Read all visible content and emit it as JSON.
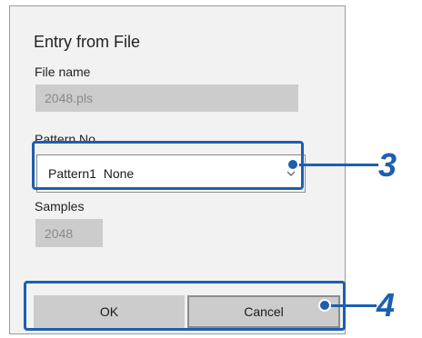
{
  "dialog": {
    "title": "Entry from File",
    "file_name": {
      "label": "File name",
      "value": "2048.pls"
    },
    "pattern_no": {
      "label": "Pattern No.",
      "selected": "Pattern1  None"
    },
    "samples": {
      "label": "Samples",
      "value": "2048"
    },
    "buttons": {
      "ok": "OK",
      "cancel": "Cancel"
    }
  },
  "callouts": {
    "pattern": "3",
    "buttons": "4"
  },
  "colors": {
    "callout": "#1e5eb0",
    "dialog_bg": "#f2f2f2",
    "disabled_field": "#cccccc",
    "button_bg": "#cccccc"
  }
}
